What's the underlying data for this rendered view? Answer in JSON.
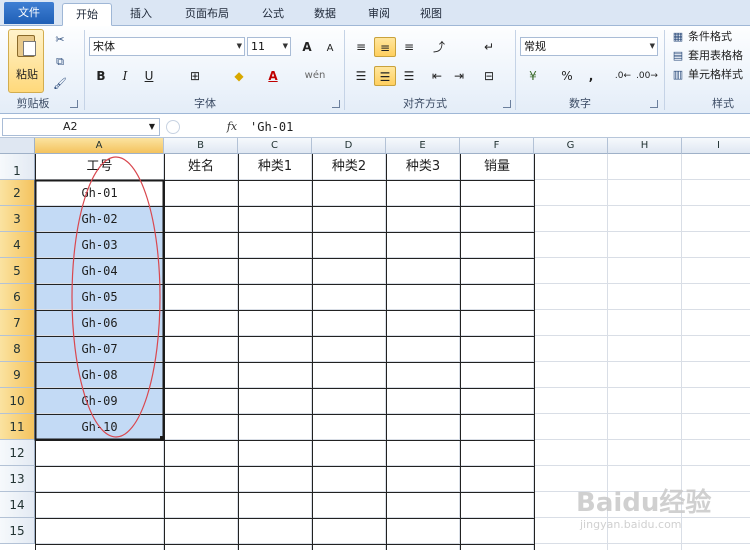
{
  "tabs": [
    "文件",
    "开始",
    "插入",
    "页面布局",
    "公式",
    "数据",
    "审阅",
    "视图"
  ],
  "ribbon": {
    "clipboard": {
      "paste_label": "粘贴",
      "group_label": "剪贴板"
    },
    "font": {
      "name": "宋体",
      "size": "11",
      "bold": "B",
      "italic": "I",
      "underline": "U",
      "group_label": "字体",
      "grow": "A",
      "shrink": "A"
    },
    "align": {
      "group_label": "对齐方式"
    },
    "number": {
      "format": "常规",
      "percent": "%",
      "comma": ",",
      "group_label": "数字"
    },
    "styles": {
      "conditional": "条件格式",
      "table_format": "套用表格格",
      "cell_styles": "单元格样式",
      "group_label": "样式"
    }
  },
  "formula_bar": {
    "name_box": "A2",
    "fx": "fx",
    "content": "'Gh-01"
  },
  "columns": [
    "A",
    "B",
    "C",
    "D",
    "E",
    "F",
    "G",
    "H",
    "I"
  ],
  "rows": [
    "1",
    "2",
    "3",
    "4",
    "5",
    "6",
    "7",
    "8",
    "9",
    "10",
    "11",
    "12",
    "13",
    "14",
    "15"
  ],
  "header_row": [
    "工号",
    "姓名",
    "种类1",
    "种类2",
    "种类3",
    "销量"
  ],
  "codes": [
    "Gh-01",
    "Gh-02",
    "Gh-03",
    "Gh-04",
    "Gh-05",
    "Gh-06",
    "Gh-07",
    "Gh-08",
    "Gh-09",
    "Gh-10"
  ],
  "selection": {
    "range": "A2:A11",
    "color": "#c3daf5",
    "active_color": "#ffffff"
  },
  "annotation": {
    "color": "#d9474e",
    "shape": "ellipse"
  },
  "watermark": {
    "main": "Baidu经验",
    "sub": "jingyan.baidu.com"
  }
}
